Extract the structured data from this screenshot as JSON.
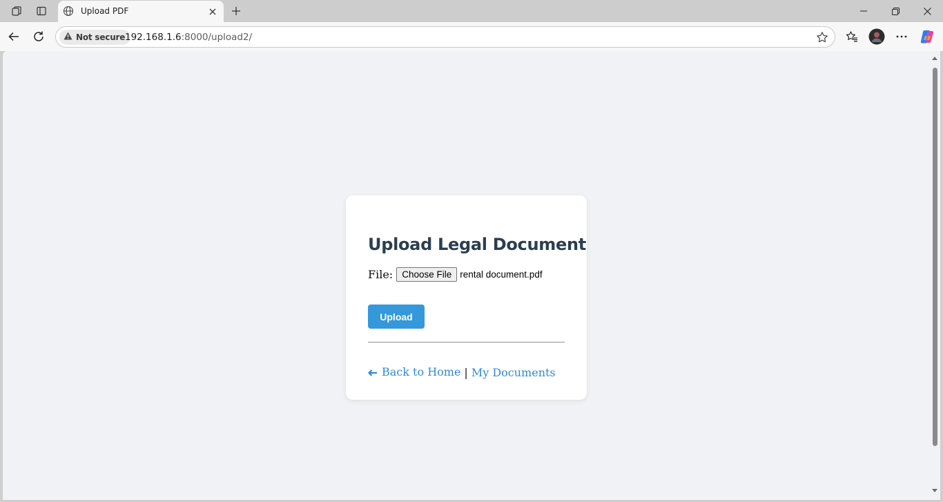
{
  "browser": {
    "tab": {
      "title": "Upload PDF"
    },
    "security_label": "Not secure",
    "url": {
      "host": "192.168.1.6",
      "path": ":8000/upload2/"
    },
    "colors": {
      "accent": "#3498db",
      "link": "#2d8ad8",
      "heading": "#2c3e50",
      "page_bg": "#f0f2f5"
    },
    "icons": [
      "workspaces-icon",
      "tab-actions-icon",
      "globe-icon",
      "close-tab-icon",
      "new-tab-icon",
      "minimize-icon",
      "restore-icon",
      "close-window-icon",
      "back-icon",
      "refresh-icon",
      "warning-icon",
      "favorite-star-icon",
      "favorites-icon",
      "profile-avatar",
      "more-icon",
      "copilot-icon"
    ]
  },
  "page": {
    "heading": "Upload Legal Document",
    "file_label": "File:",
    "choose_file_label": "Choose File",
    "selected_file": "rental document.pdf",
    "upload_label": "Upload",
    "back_home_label": "Back to Home",
    "separator": "|",
    "my_documents_label": "My Documents"
  }
}
